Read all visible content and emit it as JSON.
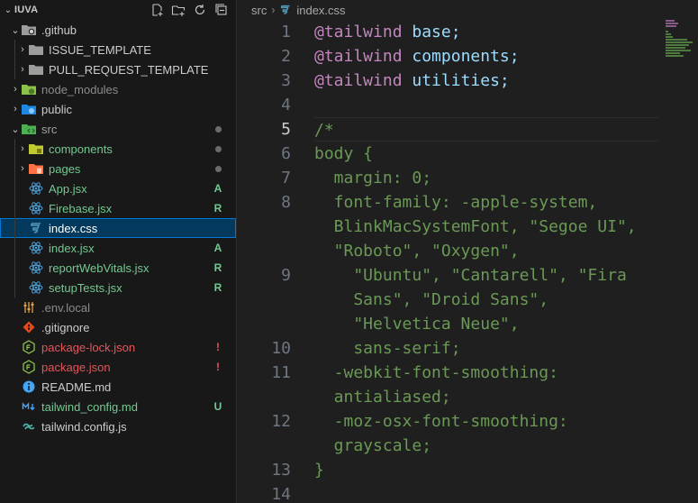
{
  "explorer": {
    "title": "IUVA",
    "items": [
      {
        "label": "ISSUE_TEMPLATE",
        "status": "",
        "dot": false
      },
      {
        "label": "PULL_REQUEST_TEMPLATE",
        "status": "",
        "dot": false
      },
      {
        "label": ".github",
        "status": "",
        "dot": false
      },
      {
        "label": "node_modules",
        "status": "",
        "dot": false
      },
      {
        "label": "public",
        "status": "",
        "dot": false
      },
      {
        "label": "src",
        "status": "",
        "dot": true
      },
      {
        "label": "components",
        "status": "",
        "dot": true
      },
      {
        "label": "pages",
        "status": "",
        "dot": true
      },
      {
        "label": "App.jsx",
        "status": "A",
        "dot": false
      },
      {
        "label": "Firebase.jsx",
        "status": "R",
        "dot": false
      },
      {
        "label": "index.css",
        "status": "",
        "dot": false
      },
      {
        "label": "index.jsx",
        "status": "A",
        "dot": false
      },
      {
        "label": "reportWebVitals.jsx",
        "status": "R",
        "dot": false
      },
      {
        "label": "setupTests.jsx",
        "status": "R",
        "dot": false
      },
      {
        "label": ".env.local",
        "status": "",
        "dot": false
      },
      {
        "label": ".gitignore",
        "status": "",
        "dot": false
      },
      {
        "label": "package-lock.json",
        "status": "!",
        "dot": false
      },
      {
        "label": "package.json",
        "status": "!",
        "dot": false
      },
      {
        "label": "README.md",
        "status": "",
        "dot": false
      },
      {
        "label": "tailwind_config.md",
        "status": "U",
        "dot": false
      },
      {
        "label": "tailwind.config.js",
        "status": "",
        "dot": false
      }
    ]
  },
  "colors": {
    "added": "#73c991",
    "renamed": "#73c991",
    "conflict": "#e2575c",
    "untracked": "#73c991",
    "folder": "#9d9d9d",
    "react": "#4d9fd6",
    "css": "#519aba",
    "selection": "#04395e"
  },
  "breadcrumb": {
    "folder": "src",
    "file": "index.css"
  },
  "code": {
    "line_numbers": [
      "1",
      "2",
      "3",
      "4",
      "5",
      "",
      "6",
      "7",
      "8",
      "",
      "",
      "9",
      "",
      "",
      "10",
      "11",
      "",
      "12",
      "",
      "13",
      "14"
    ],
    "active_line": "5",
    "lines": [
      [
        "@tailwind",
        " base;"
      ],
      [
        "@tailwind",
        " components;"
      ],
      [
        "@tailwind",
        " utilities;"
      ],
      [
        ""
      ],
      [
        "/*"
      ],
      [
        "body {"
      ],
      [
        "  margin: 0;"
      ],
      [
        "  font-family: -apple-system,"
      ],
      [
        "  BlinkMacSystemFont, \"Segoe UI\","
      ],
      [
        "  \"Roboto\", \"Oxygen\","
      ],
      [
        "    \"Ubuntu\", \"Cantarell\", \"Fira"
      ],
      [
        "    Sans\", \"Droid Sans\","
      ],
      [
        "    \"Helvetica Neue\","
      ],
      [
        "    sans-serif;"
      ],
      [
        "  -webkit-font-smoothing:"
      ],
      [
        "  antialiased;"
      ],
      [
        "  -moz-osx-font-smoothing:"
      ],
      [
        "  grayscale;"
      ],
      [
        "}"
      ],
      [
        ""
      ]
    ]
  }
}
